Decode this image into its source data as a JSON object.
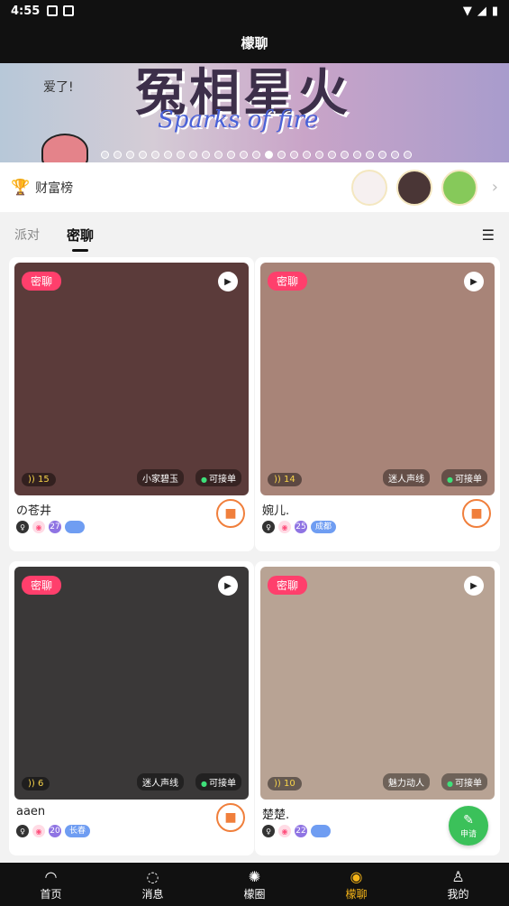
{
  "status_bar": {
    "time": "4:55"
  },
  "app_bar": {
    "title": "檬聊"
  },
  "banner": {
    "title": "冤相星火",
    "subtitle": "Sparks of fire",
    "note": "爱了!",
    "dots_total": 25,
    "active_dot": 13
  },
  "wealth": {
    "label": "财富榜"
  },
  "tabs": [
    {
      "label": "派对"
    },
    {
      "label": "密聊"
    }
  ],
  "cards": [
    {
      "badge": "密聊",
      "heat": "15",
      "tag": "小家碧玉",
      "avail": "可接单",
      "name": "の苍井",
      "age": "27",
      "city": "",
      "photo": "#5b3b3a"
    },
    {
      "badge": "密聊",
      "heat": "14",
      "tag": "迷人声线",
      "avail": "可接单",
      "name": "婉儿.",
      "age": "25",
      "city": "成都",
      "photo": "#a88478"
    },
    {
      "badge": "密聊",
      "heat": "6",
      "tag": "迷人声线",
      "avail": "可接单",
      "name": "aaen",
      "age": "20",
      "city": "长春",
      "photo": "#3a3838"
    },
    {
      "badge": "密聊",
      "heat": "10",
      "tag": "魅力动人",
      "avail": "可接单",
      "name": "楚楚.",
      "age": "22",
      "city": "",
      "photo": "#b8a394"
    }
  ],
  "apply_button": {
    "label": "申请"
  },
  "bottom_nav": [
    {
      "label": "首页",
      "icon": "home-icon"
    },
    {
      "label": "消息",
      "icon": "message-icon"
    },
    {
      "label": "檬圈",
      "icon": "circle-icon"
    },
    {
      "label": "檬聊",
      "icon": "chat-icon",
      "active": true
    },
    {
      "label": "我的",
      "icon": "profile-icon"
    }
  ]
}
